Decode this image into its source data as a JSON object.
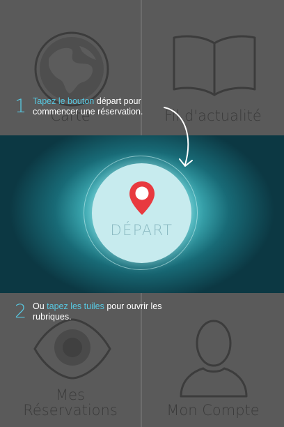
{
  "tiles": {
    "carte": "Carte",
    "fil": "Fil d'actualité",
    "reservations_line1": "Mes",
    "reservations_line2": "Réservations",
    "compte": "Mon Compte"
  },
  "depart": {
    "label": "DÉPART",
    "icon": "location-pin-icon"
  },
  "step1": {
    "number": "1",
    "highlight": "Tapez le bouton",
    "text_after_highlight": " départ pour",
    "line2": "commencer une réservation."
  },
  "step2": {
    "number": "2",
    "text_before_highlight": "Ou ",
    "highlight": "tapez les tuiles",
    "text_after_highlight": " pour ouvrir les",
    "line2": "rubriques."
  },
  "colors": {
    "accent": "#57c7e0",
    "pin": "#e8393f",
    "tile": "#5a5a5a",
    "band_center": "#e8fbfb",
    "band_edge": "#0c3843"
  }
}
